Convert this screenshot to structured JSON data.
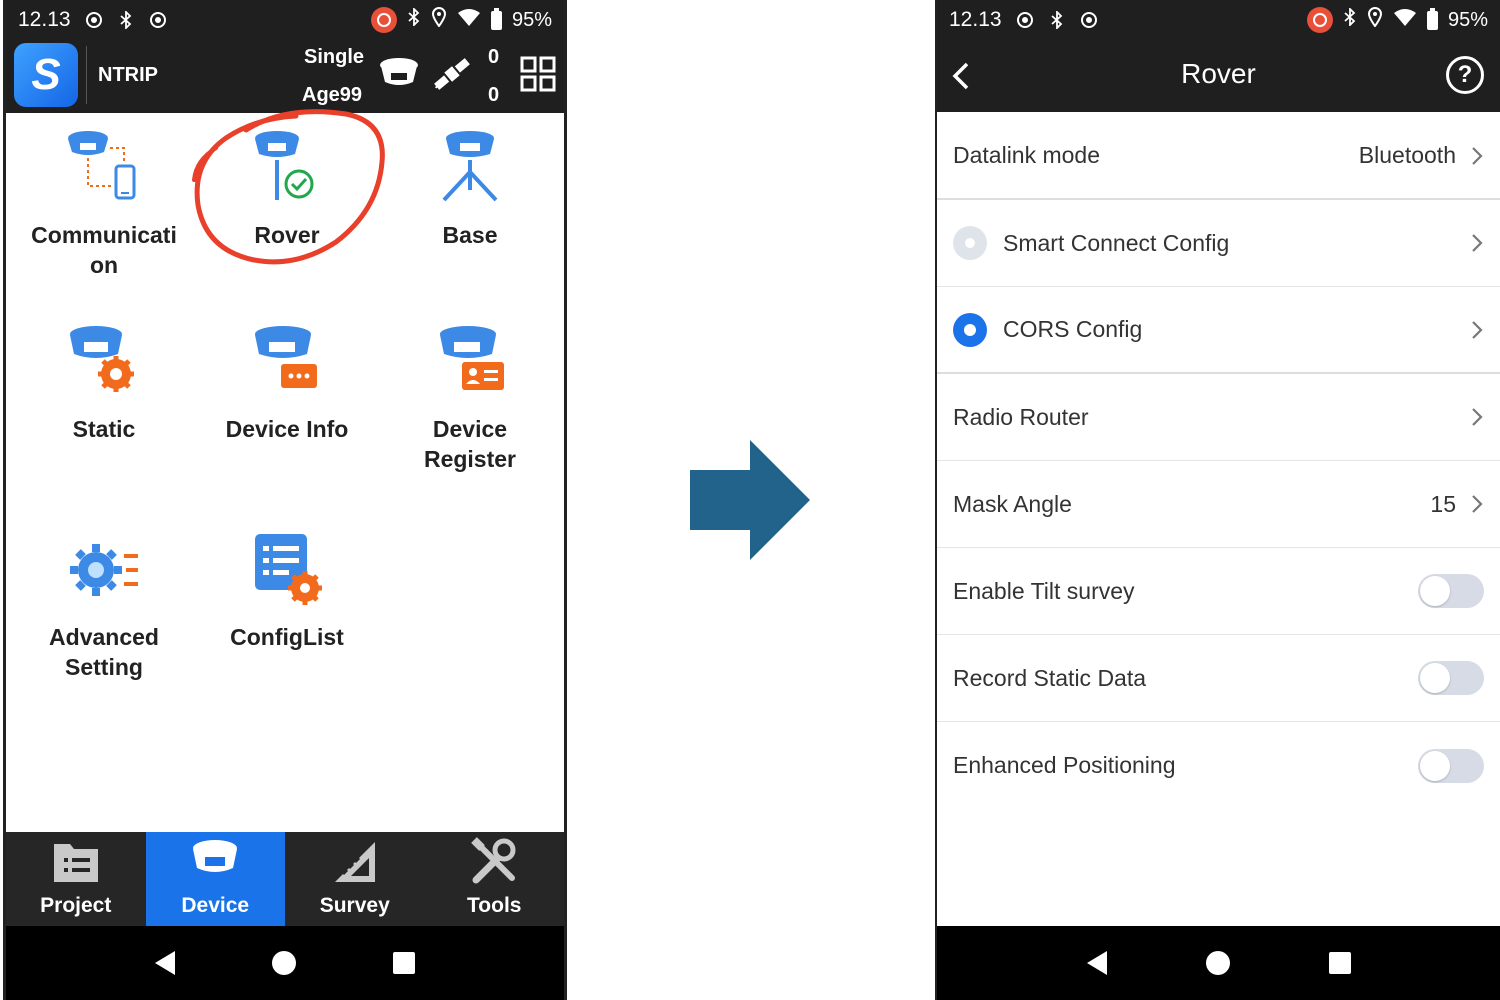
{
  "status_bar": {
    "time": "12.13",
    "battery": "95%"
  },
  "left_app": {
    "header": {
      "logo_letter": "S",
      "mode": "NTRIP",
      "solution": "Single",
      "age": "Age99",
      "count_top": "0",
      "count_bottom": "0"
    },
    "grid": [
      {
        "label_line1": "Communicati",
        "label_line2": "on",
        "icon": "communication-icon"
      },
      {
        "label_line1": "Rover",
        "label_line2": "",
        "icon": "rover-icon"
      },
      {
        "label_line1": "Base",
        "label_line2": "",
        "icon": "base-icon"
      },
      {
        "label_line1": "Static",
        "label_line2": "",
        "icon": "static-icon"
      },
      {
        "label_line1": "Device Info",
        "label_line2": "",
        "icon": "device-info-icon"
      },
      {
        "label_line1": "Device",
        "label_line2": "Register",
        "icon": "device-register-icon"
      },
      {
        "label_line1": "Advanced",
        "label_line2": "Setting",
        "icon": "advanced-setting-icon"
      },
      {
        "label_line1": "ConfigList",
        "label_line2": "",
        "icon": "config-list-icon"
      }
    ],
    "bottom_nav": [
      {
        "label": "Project",
        "active": false
      },
      {
        "label": "Device",
        "active": true
      },
      {
        "label": "Survey",
        "active": false
      },
      {
        "label": "Tools",
        "active": false
      }
    ]
  },
  "right_app": {
    "title": "Rover",
    "help_label": "?",
    "rows": {
      "datalink_mode": {
        "label": "Datalink mode",
        "value": "Bluetooth"
      },
      "smart_connect": {
        "label": "Smart Connect Config",
        "selected": false
      },
      "cors_config": {
        "label": "CORS Config",
        "selected": true
      },
      "radio_router": {
        "label": "Radio Router"
      },
      "mask_angle": {
        "label": "Mask Angle",
        "value": "15"
      },
      "enable_tilt": {
        "label": "Enable Tilt survey",
        "on": false
      },
      "record_static": {
        "label": "Record Static Data",
        "on": false
      },
      "enhanced_positioning": {
        "label": "Enhanced Positioning",
        "on": false
      }
    }
  },
  "colors": {
    "accent": "#1a73e8",
    "orange": "#f26b1d",
    "annotation_red": "#e8402a",
    "arrow": "#21638a",
    "bar_dark": "#1f1f1f"
  }
}
